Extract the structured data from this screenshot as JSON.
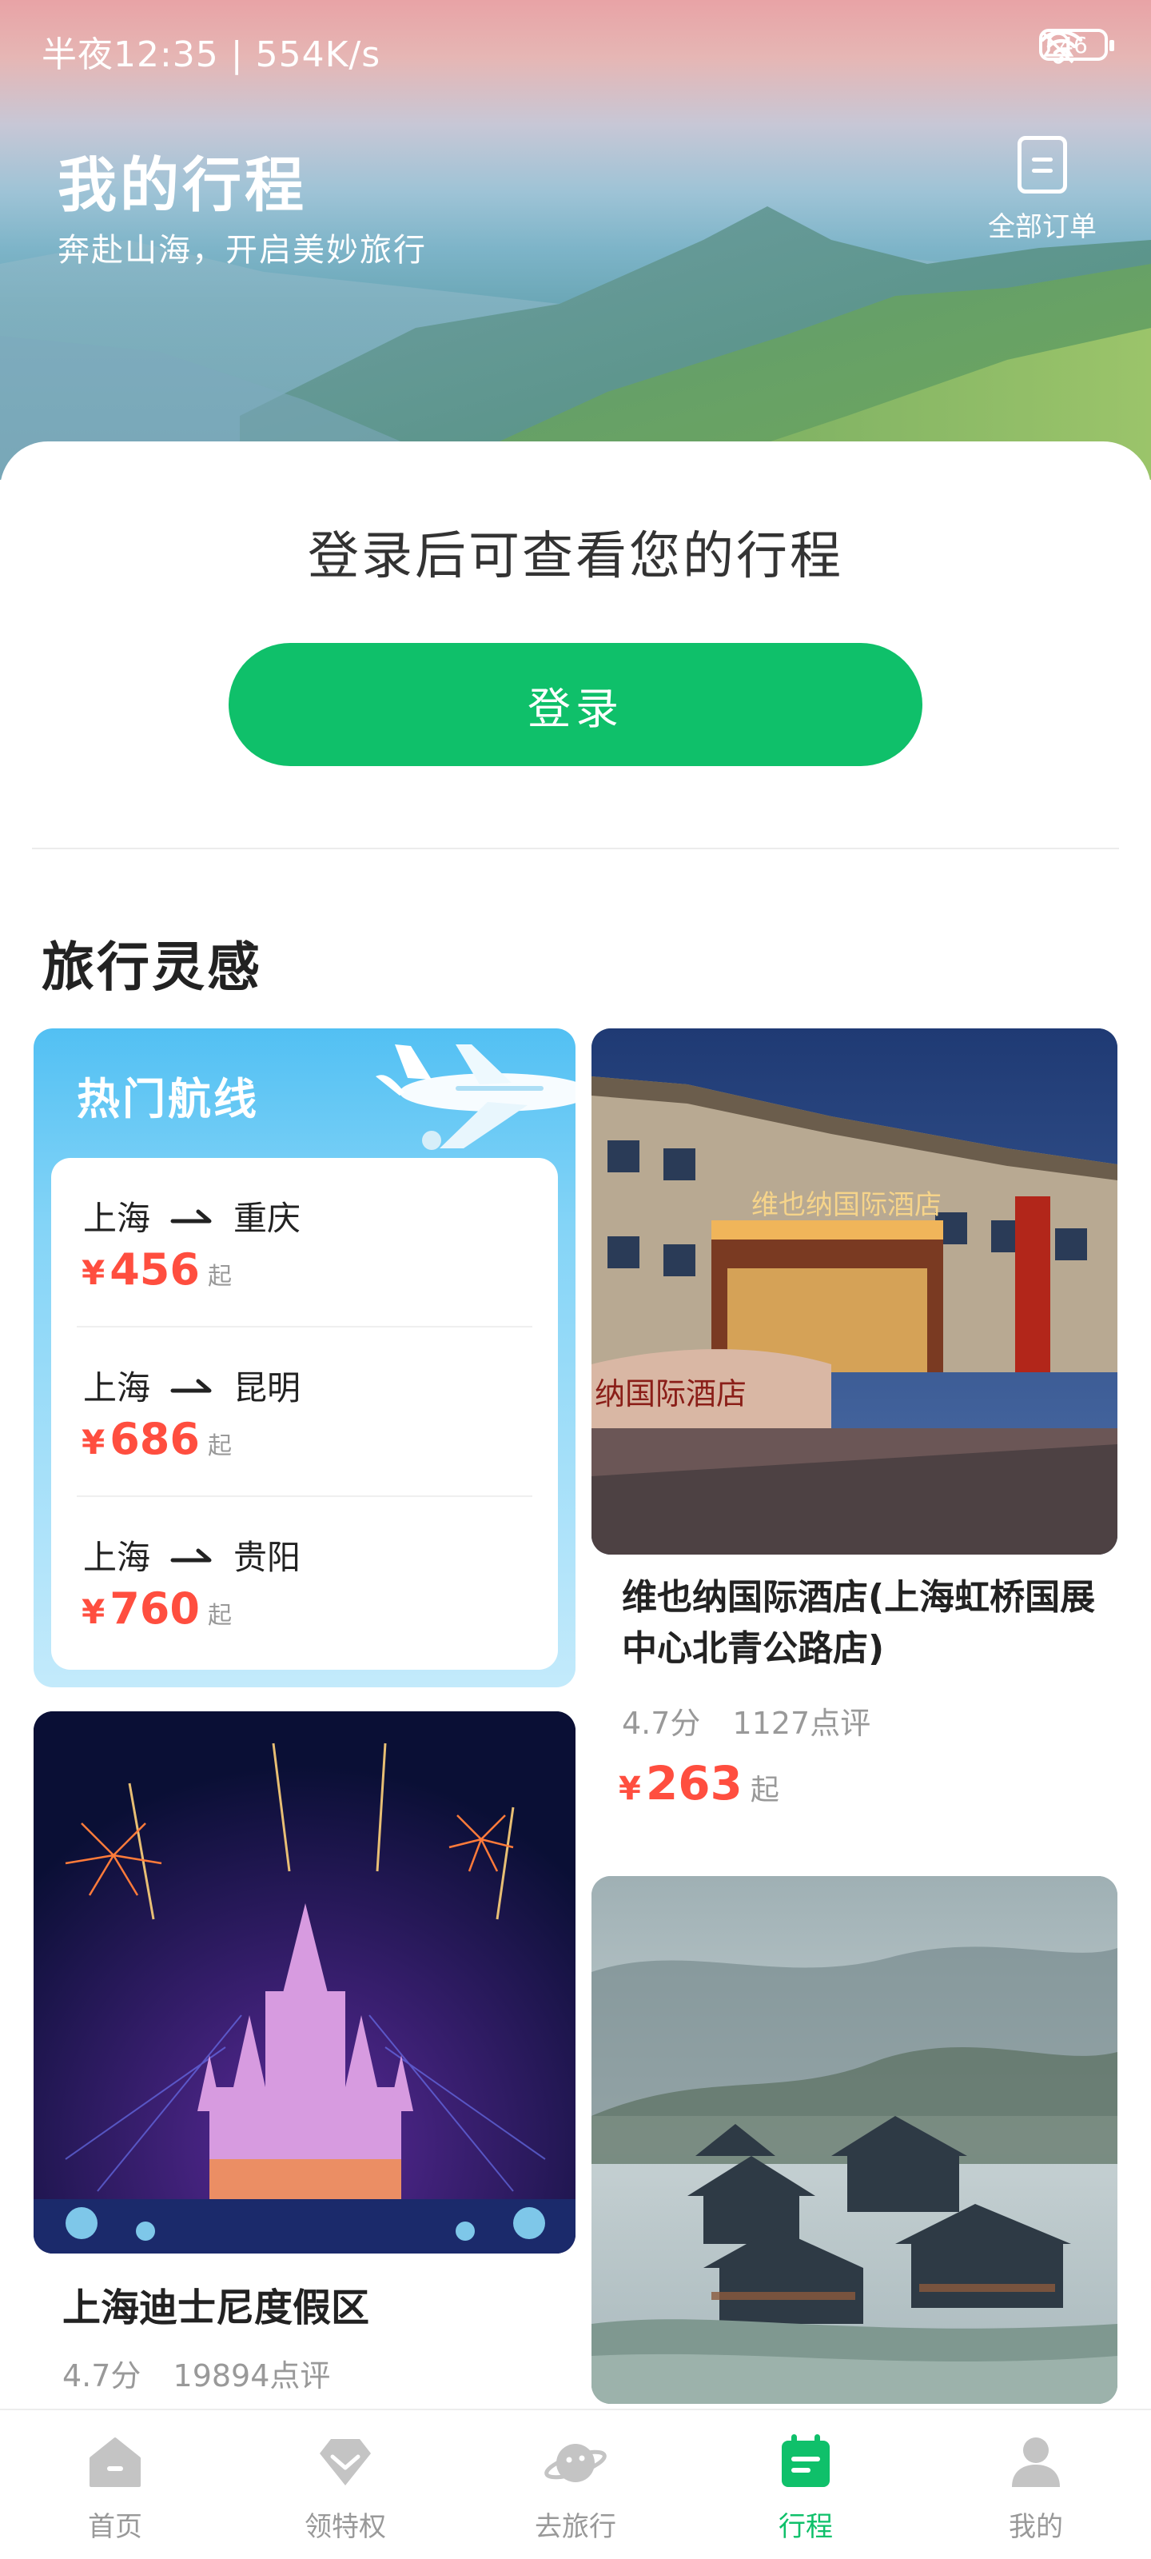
{
  "status_bar": {
    "time": "半夜12:35 | 554K/s",
    "battery": "46"
  },
  "header": {
    "title": "我的行程",
    "subtitle": "奔赴山海，开启美妙旅行",
    "orders_label": "全部订单"
  },
  "login": {
    "prompt": "登录后可查看您的行程",
    "button_label": "登录"
  },
  "inspiration": {
    "section_title": "旅行灵感",
    "hot_routes": {
      "title": "热门航线",
      "currency": "¥",
      "suffix": "起",
      "routes": [
        {
          "from": "上海",
          "to": "重庆",
          "price": "456"
        },
        {
          "from": "上海",
          "to": "昆明",
          "price": "686"
        },
        {
          "from": "上海",
          "to": "贵阳",
          "price": "760"
        }
      ]
    },
    "hotel": {
      "name": "维也纳国际酒店(上海虹桥国展中心北青公路店)",
      "rating": "4.7分",
      "reviews": "1127点评",
      "currency": "¥",
      "price": "263",
      "suffix": "起",
      "sign_text": "维也纳国际酒店",
      "wall_text": "纳国际酒店"
    },
    "disney": {
      "name": "上海迪士尼度假区",
      "rating": "4.7分",
      "reviews": "19894点评"
    }
  },
  "bottom_nav": {
    "items": [
      {
        "label": "首页",
        "icon": "home-icon"
      },
      {
        "label": "领特权",
        "icon": "diamond-icon"
      },
      {
        "label": "去旅行",
        "icon": "planet-icon"
      },
      {
        "label": "行程",
        "icon": "calendar-icon"
      },
      {
        "label": "我的",
        "icon": "person-icon"
      }
    ],
    "active_index": 3,
    "active_color": "#0fc06a",
    "inactive_color": "#bfbfbf"
  },
  "colors": {
    "brand_green": "#0fc06a",
    "price_red": "#ff4e3f"
  }
}
